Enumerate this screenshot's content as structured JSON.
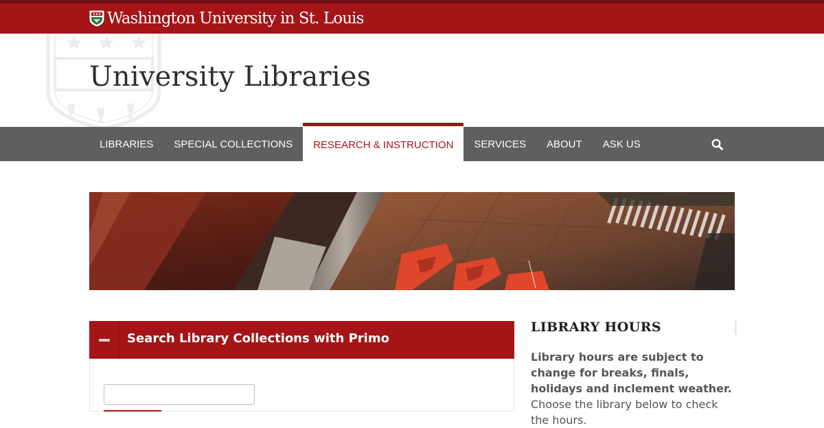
{
  "university": {
    "name": "Washington University in St. Louis"
  },
  "site": {
    "title": "University Libraries"
  },
  "nav": {
    "items": [
      {
        "label": "LIBRARIES"
      },
      {
        "label": "SPECIAL COLLECTIONS"
      },
      {
        "label": "RESEARCH & INSTRUCTION",
        "active": true
      },
      {
        "label": "SERVICES"
      },
      {
        "label": "ABOUT"
      },
      {
        "label": "ASK US"
      }
    ],
    "search_icon": "search-icon"
  },
  "search_panel": {
    "title": "Search Library Collections with Primo",
    "toggle_icon": "minus-icon",
    "input_value": ""
  },
  "hours": {
    "title": "LIBRARY HOURS",
    "bold_text": "Library hours are subject to change for breaks, finals, holidays and inclement weather.",
    "text": " Choose the library below to check the hours."
  },
  "colors": {
    "brand_red": "#a51417",
    "nav_gray": "#5f5f5f",
    "dark_red": "#6d0f14"
  }
}
